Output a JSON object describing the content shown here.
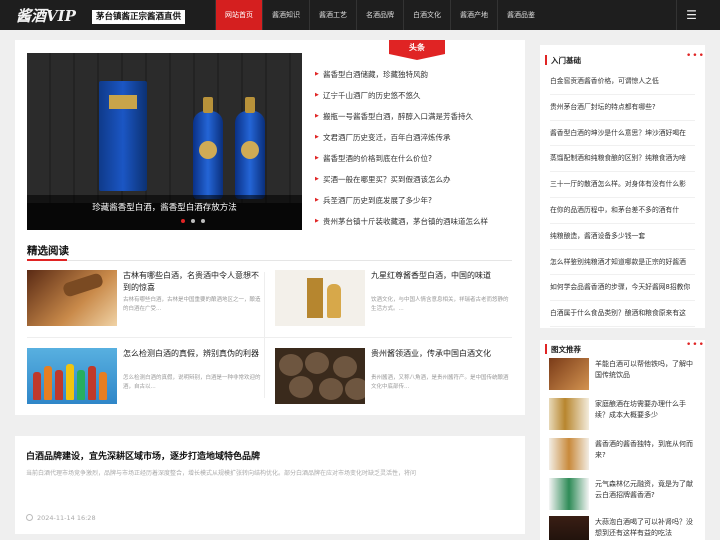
{
  "header": {
    "logo": "酱酒VIP",
    "slogan": "茅台镇酱正宗酱酒直供",
    "nav": [
      "网站首页",
      "酱酒知识",
      "酱酒工艺",
      "名酒品牌",
      "白酒文化",
      "酱酒产地",
      "酱酒品鉴"
    ],
    "menu_icon": "☰"
  },
  "headline_tag": "头条",
  "slider": {
    "caption": "珍藏酱香型白酒，酱香型白酒存放方法"
  },
  "headlines": [
    "酱香型白酒储藏，珍藏独特风韵",
    "辽宁千山酒厂的历史悠不悠久",
    "搬瓶一号酱香型白酒，醉醇入口满是芳香持久",
    "文君酒厂历史变迁，百年白酒淬炼传承",
    "酱香型酒的价格到底在什么价位?",
    "买酒一般在哪里买？买到假酒该怎么办",
    "兵圣酒厂历史到底发展了多少年?",
    "贵州茅台镇十斤装收藏酒，茅台镇的酒味道怎么样"
  ],
  "section_title": "精选阅读",
  "articles": [
    {
      "title": "古林有哪些白酒，名贵酒中令人意想不到的惊喜",
      "desc": "古林有哪些白酒，古林是中国重要的酿酒地区之一，酿造的白酒在广受..."
    },
    {
      "title": "九星红尊酱香型白酒，中国的味道",
      "desc": "饮酒文化，与中国人情含意息相关，祥瑞者古老而悠静的生活方式。..."
    },
    {
      "title": "怎么检测白酒的真假，辨别真伪的利器",
      "desc": "怎么检测白酒的真假，说明辩别，白酒是一种非常欢迎的酒，自古以..."
    },
    {
      "title": "贵州酱领酒业，传承中国白酒文化",
      "desc": "贵州酱酒，又称八角酒，是贵州酱符产。是中国传统酿酒文化中底部传..."
    }
  ],
  "featured": {
    "title": "白酒品牌建设，宜先深耕区域市场，逐步打造地域特色品牌",
    "desc": "当前白酒代理市场竞争激烈，品牌与市场正经历着深度整合，增长模式从规模扩张转向结构优化。部分白酒品牌在应对市场变化时缺乏灵活性，将问",
    "date": "2024-11-14 16:28"
  },
  "sidebar": {
    "basics_title": "入门基础",
    "more": "•••",
    "basics": [
      "白金窖贡酒酱香价格，可谓惊人之低",
      "贵州茅台酒厂封坛的特点都有哪些?",
      "酱香型白酒的坤沙是什么意思？坤沙酒好喝在",
      "蒸馏配制酒和纯粮食酿的区别？纯粮食酒为啥",
      "三十一厅的散酒怎么样。对身体有没有什么影",
      "在你的品酒历程中，和茅台差不多的酒有什",
      "纯粮酿造，酱酒设备多少钱一套",
      "怎么样鉴别纯粮酒才知道哪款是正宗的好酱酒",
      "如何学会品酱香酒的步骤，今天好酱网8招教你",
      "白酒属于什么食品类别？酿酒和粮食原来有这"
    ],
    "rec_title": "图文推荐",
    "recs": [
      "羊能白酒可以帮他铁吗，了解中国传统饮品",
      "家庭酿酒在坊需要办理什么手续？成本大概要多少",
      "酱香酒的酱香独特，到底从何而来?",
      "元气森林亿元融资，竟是为了献云白酒招牌酱香酒?",
      "大蒜泡白酒喝了可以补肾吗？没想到还有这样有益的吃法"
    ]
  },
  "colors": {
    "accent": "#e02424",
    "nav_bg": "#1e1e1e",
    "page_bg": "#efefef"
  }
}
